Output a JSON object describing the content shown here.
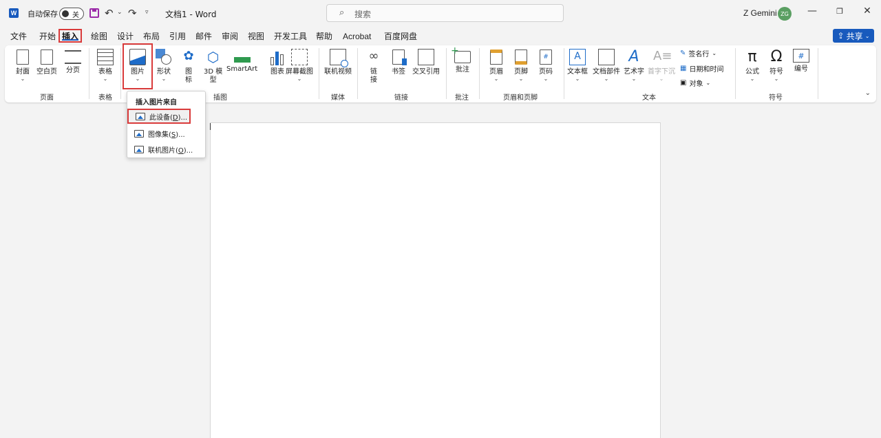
{
  "titlebar": {
    "app_icon": "word-logo",
    "autosave_label": "自动保存",
    "autosave_state": "关",
    "doc_title": "文档1 - Word",
    "search_placeholder": "搜索",
    "user_name": "Z Gemini",
    "user_initials": "ZG"
  },
  "menu": {
    "tabs": [
      "文件",
      "开始",
      "插入",
      "绘图",
      "设计",
      "布局",
      "引用",
      "邮件",
      "审阅",
      "视图",
      "开发工具",
      "帮助",
      "Acrobat",
      "百度网盘"
    ],
    "active_tab": "插入",
    "share_label": "共享"
  },
  "ribbon": {
    "buttons": {
      "cover": "封面",
      "blank_page": "空白页",
      "page_break": "分页",
      "table": "表格",
      "picture": "图片",
      "shapes": "形状",
      "icons_1": "图",
      "icons_2": "标",
      "model3d_1": "3D 模",
      "model3d_2": "型",
      "smartart": "SmartArt",
      "chart": "图表",
      "screenshot": "屏幕截图",
      "online_video": "联机视频",
      "link_1": "链",
      "link_2": "接",
      "bookmark": "书签",
      "cross_ref": "交叉引用",
      "comment": "批注",
      "header": "页眉",
      "footer": "页脚",
      "page_number": "页码",
      "textbox": "文本框",
      "quick_parts": "文档部件",
      "wordart": "艺术字",
      "drop_cap": "首字下沉",
      "signature_line": "签名行",
      "date_time": "日期和时间",
      "object": "对象",
      "equation": "公式",
      "symbol": "符号",
      "number": "编号"
    },
    "groups": {
      "pages": "页面",
      "tables": "表格",
      "illustrations": "插图",
      "media": "媒体",
      "links": "链接",
      "comments": "批注",
      "header_footer": "页眉和页脚",
      "text": "文本",
      "symbols": "符号"
    }
  },
  "dropdown": {
    "header": "插入图片来自",
    "items": [
      {
        "label": "此设备",
        "accel": "D",
        "suffix": ")..."
      },
      {
        "label": "图像集",
        "accel": "S",
        "suffix": ")..."
      },
      {
        "label": "联机图片",
        "accel": "O",
        "suffix": ")..."
      }
    ]
  },
  "colors": {
    "accent": "#185abd",
    "highlight_box": "#d93a3a",
    "avatar": "#5a9f62"
  }
}
